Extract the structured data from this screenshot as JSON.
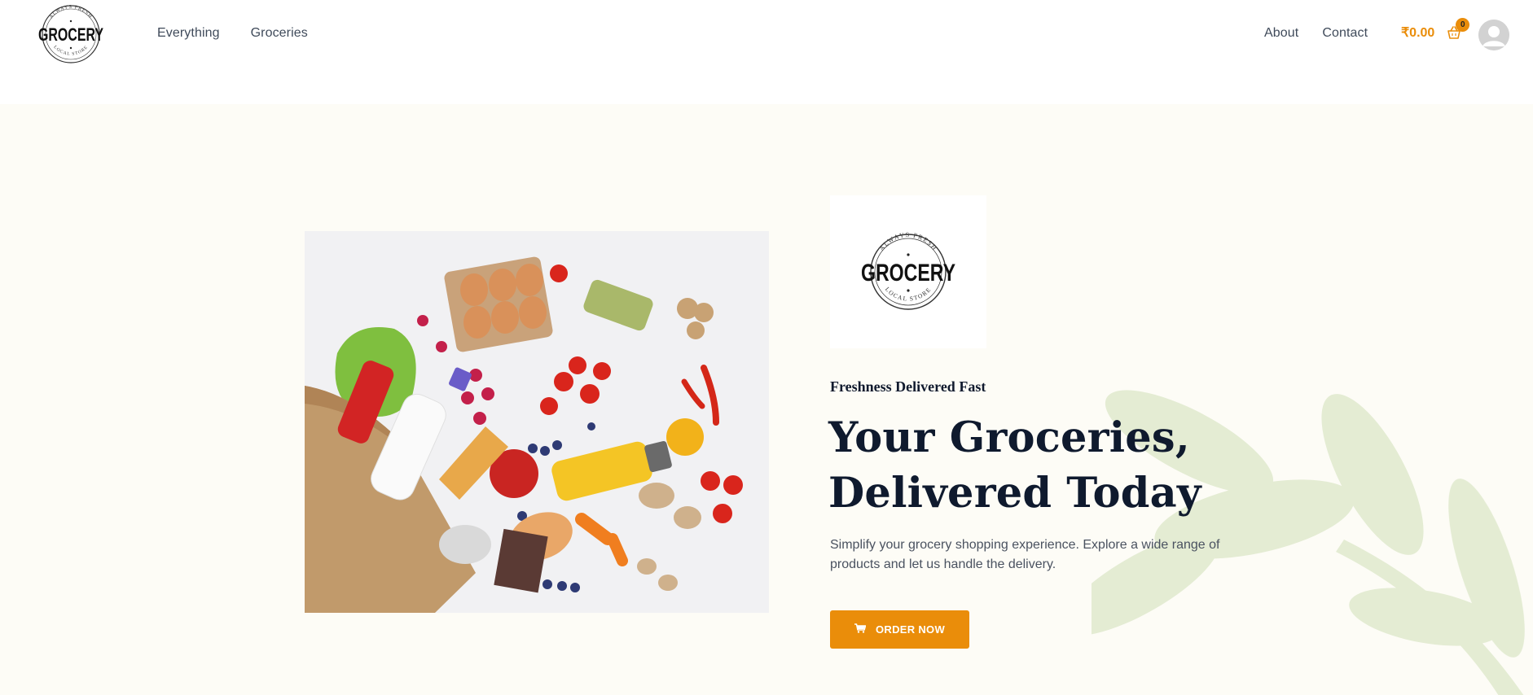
{
  "header": {
    "logo": {
      "main": "GROCERY",
      "top_arc": "ALWAYS FRESH",
      "bottom_arc": "LOCAL STORE"
    },
    "nav_left": [
      "Everything",
      "Groceries"
    ],
    "nav_right": [
      "About",
      "Contact"
    ],
    "cart": {
      "total": "₹0.00",
      "count": "0"
    },
    "icons": {
      "cart": "basket-icon",
      "avatar": "user-avatar-icon"
    }
  },
  "hero": {
    "image_alt": "grocery-bag-with-produce",
    "brand_logo": {
      "main": "GROCERY",
      "top_arc": "ALWAYS FRESH",
      "bottom_arc": "LOCAL STORE"
    },
    "eyebrow": "Freshness Delivered Fast",
    "headline_line1": "Your Groceries,",
    "headline_line2": "Delivered Today",
    "description": "Simplify your grocery shopping experience. Explore a wide range of products and let us handle the delivery.",
    "cta": {
      "label": "ORDER NOW",
      "icon": "cart-icon"
    }
  },
  "colors": {
    "accent": "#ea8d0a",
    "hero_bg": "#fdfcf6",
    "heading": "#0f1a2e",
    "leaf": "#dfe9cd"
  }
}
